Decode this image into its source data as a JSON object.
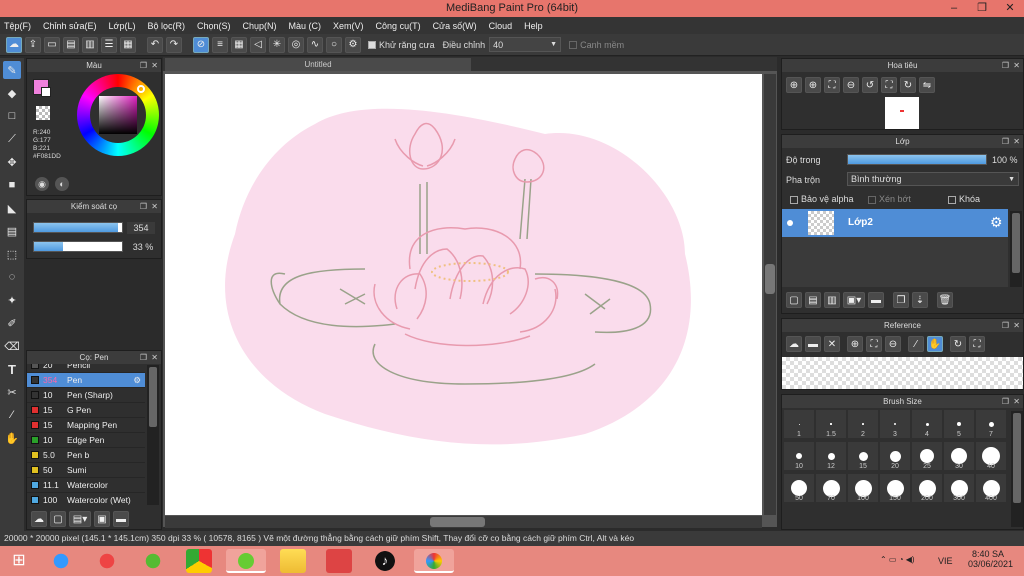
{
  "window": {
    "title": "MediBang Paint Pro (64bit)"
  },
  "menu": [
    "Tệp(F)",
    "Chỉnh sửa(E)",
    "Lớp(L)",
    "Bộ lọc(R)",
    "Chọn(S)",
    "Chụp(N)",
    "Màu (C)",
    "Xem(V)",
    "Công cụ(T)",
    "Cửa số(W)",
    "Cloud",
    "Help"
  ],
  "toolbar": {
    "antialias_label": "Khử răng cưa",
    "adjust_label": "Điều chỉnh",
    "adjust_value": "40",
    "edge_label": "Canh mềm"
  },
  "color_panel": {
    "title": "Màu",
    "r": "R:240",
    "g": "G:177",
    "b": "B:221",
    "hex": "#F081DD",
    "primary": "#f081dd",
    "secondary": "#ffffff"
  },
  "brush_control": {
    "title": "Kiểm soát cọ",
    "size": "354",
    "opacity": "33 %",
    "size_fill": 0.95,
    "opacity_fill": 0.33
  },
  "brush_panel": {
    "title": "Cọ: Pen",
    "items": [
      {
        "size": "20",
        "name": "Pencil",
        "color": "#555555"
      },
      {
        "size": "354",
        "name": "Pen",
        "color": "#333333",
        "selected": true
      },
      {
        "size": "10",
        "name": "Pen (Sharp)",
        "color": "#333333"
      },
      {
        "size": "15",
        "name": "G Pen",
        "color": "#e03030"
      },
      {
        "size": "15",
        "name": "Mapping Pen",
        "color": "#e03030"
      },
      {
        "size": "10",
        "name": "Edge Pen",
        "color": "#2aa02a"
      },
      {
        "size": "5.0",
        "name": "Pen b",
        "color": "#e0c020"
      },
      {
        "size": "50",
        "name": "Sumi",
        "color": "#e0c020"
      },
      {
        "size": "11.1",
        "name": "Watercolor",
        "color": "#4fa8e0"
      },
      {
        "size": "100",
        "name": "Watercolor (Wet)",
        "color": "#4fa8e0"
      }
    ]
  },
  "document": {
    "tab": "Untitled"
  },
  "navigator": {
    "title": "Hoa tiêu"
  },
  "layer_panel": {
    "title": "Lớp",
    "opacity_label": "Độ trong",
    "opacity_value": "100 %",
    "blend_label": "Pha trộn",
    "blend_value": "Bình thường",
    "protect_alpha": "Bảo vệ alpha",
    "clip": "Xén bớt",
    "lock": "Khóa",
    "layer_name": "Lớp2"
  },
  "reference": {
    "title": "Reference"
  },
  "brush_size": {
    "title": "Brush Size",
    "sizes": [
      "1",
      "1.5",
      "2",
      "3",
      "4",
      "5",
      "7",
      "10",
      "12",
      "15",
      "20",
      "25",
      "30",
      "40",
      "50",
      "70",
      "100",
      "150",
      "200",
      "300",
      "400"
    ]
  },
  "status": "20000 * 20000 pixel  (145.1 * 145.1cm)  350 dpi  33 %  ( 10578, 8165 )  Vẽ một đường thẳng bằng cách giữ phím Shift, Thay đổi cỡ cọ bằng cách giữ phím Ctrl, Alt và kéo",
  "taskbar": {
    "lang": "VIE",
    "time": "8:40 SA",
    "date": "03/06/2021"
  }
}
